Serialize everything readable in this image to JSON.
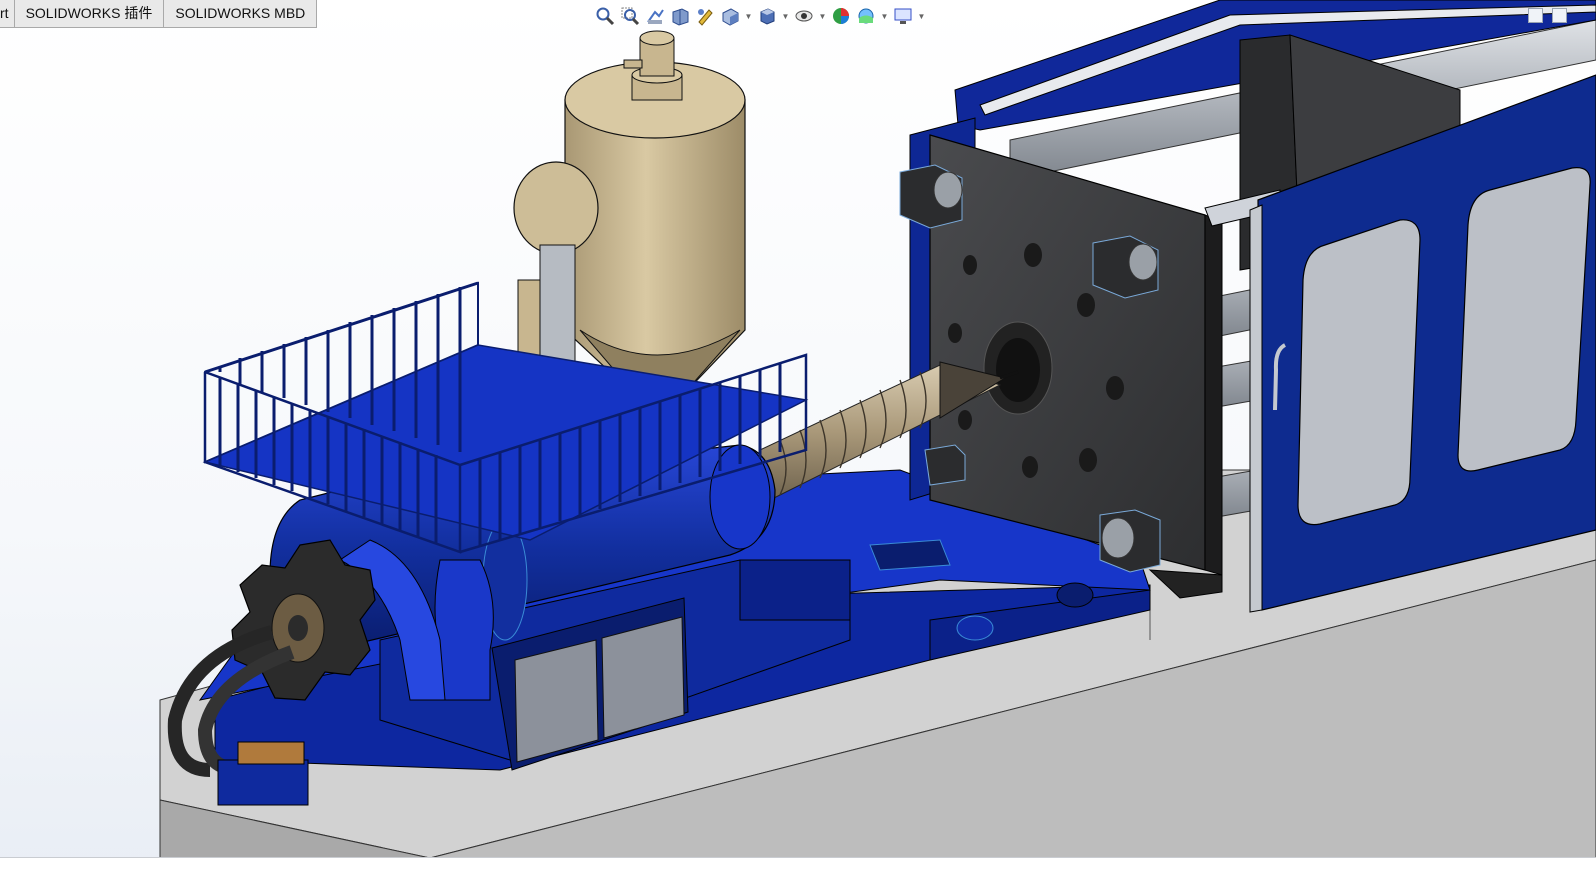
{
  "window": {
    "app": "SOLIDWORKS"
  },
  "command_tabs": [
    {
      "label": "rt"
    },
    {
      "label": "SOLIDWORKS 插件"
    },
    {
      "label": "SOLIDWORKS MBD"
    }
  ],
  "heads_up_toolbar": [
    {
      "icon": "zoom-to-fit-icon"
    },
    {
      "icon": "zoom-to-area-icon"
    },
    {
      "icon": "previous-view-icon"
    },
    {
      "icon": "section-view-icon"
    },
    {
      "icon": "dynamic-annotation-icon"
    },
    {
      "icon": "view-orientation-icon"
    },
    {
      "icon": "display-style-icon"
    },
    {
      "icon": "hide-show-items-icon"
    },
    {
      "icon": "edit-appearance-icon"
    },
    {
      "icon": "apply-scene-icon"
    },
    {
      "icon": "view-settings-icon"
    }
  ],
  "model": {
    "name": "injection-molding-machine",
    "colors": {
      "frame_blue": "#0f2a9e",
      "dark_blue": "#0a1d6e",
      "bright_blue": "#1c3fd6",
      "hopper_tan": "#c8b68f",
      "screw_tan": "#bfae8c",
      "platen_dark": "#3a3b3d",
      "base_gray": "#c9c9c9",
      "rod_gray": "#b8bcc2",
      "door_blue": "#0e2b8f"
    }
  }
}
